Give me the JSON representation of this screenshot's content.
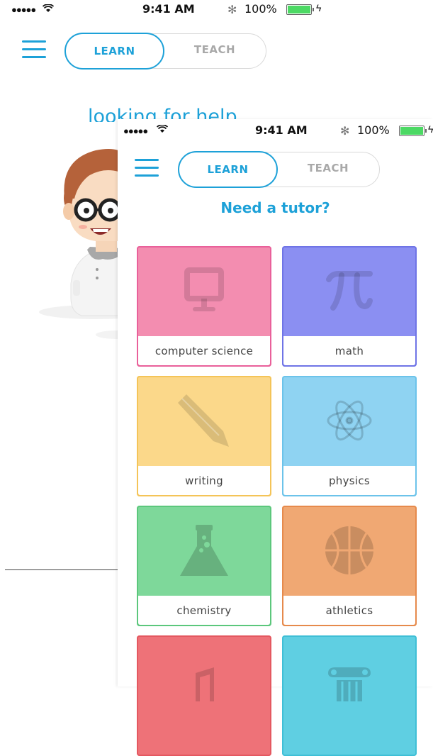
{
  "status_bar": {
    "signal": "●●●●●",
    "wifi": "wifi-icon",
    "time": "9:41 AM",
    "bluetooth": "✻",
    "battery_percent": "100%",
    "battery_level": 1.0,
    "charging": "ϟ"
  },
  "nav": {
    "learn_label": "LEARN",
    "teach_label": "TEACH",
    "active_tab": "LEARN"
  },
  "back_screen": {
    "heading": "looking for help"
  },
  "front_screen": {
    "heading": "Need a tutor?",
    "subjects": [
      {
        "label": "computer science",
        "icon": "monitor-icon",
        "color": "#f38db0",
        "border": "#e9609a"
      },
      {
        "label": "math",
        "icon": "pi-icon",
        "color": "#8b8ff2",
        "border": "#6f74e6"
      },
      {
        "label": "writing",
        "icon": "pencil-icon",
        "color": "#fbd88a",
        "border": "#f4c458"
      },
      {
        "label": "physics",
        "icon": "atom-icon",
        "color": "#8fd3f2",
        "border": "#6cc3ea"
      },
      {
        "label": "chemistry",
        "icon": "flask-icon",
        "color": "#7ed89a",
        "border": "#5cc77c"
      },
      {
        "label": "athletics",
        "icon": "basketball-icon",
        "color": "#f0a873",
        "border": "#e68a4c"
      },
      {
        "label": "",
        "icon": "music-icon",
        "color": "#ee7278",
        "border": "#e45860"
      },
      {
        "label": "",
        "icon": "column-icon",
        "color": "#5fcfe2",
        "border": "#3fbfd6"
      }
    ]
  }
}
